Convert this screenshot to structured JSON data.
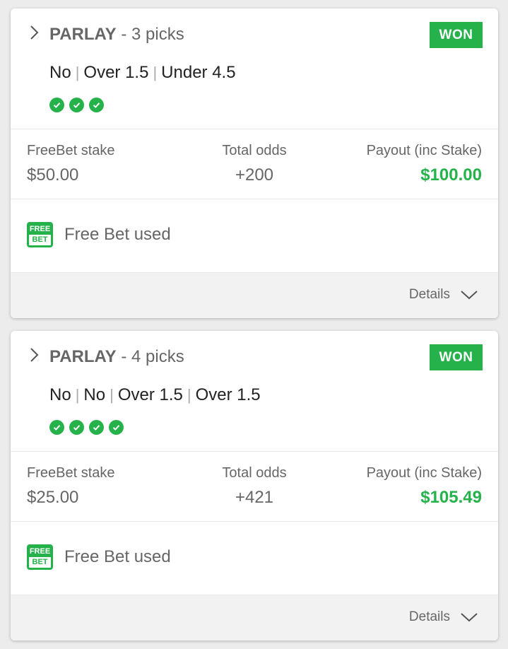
{
  "colors": {
    "accent": "#25b24a",
    "text_dark": "#222222",
    "text_muted": "#666666"
  },
  "bets": [
    {
      "type": "PARLAY",
      "picks_count": "- 3 picks",
      "status": "WON",
      "selections": [
        "No",
        "Over 1.5",
        "Under 4.5"
      ],
      "checks": 3,
      "stake_label": "FreeBet stake",
      "stake_value": "$50.00",
      "odds_label": "Total odds",
      "odds_value": "+200",
      "payout_label": "Payout (inc Stake)",
      "payout_value": "$100.00",
      "freebet_icon_top": "FREE",
      "freebet_icon_bottom": "BET",
      "freebet_text": "Free Bet used",
      "details_label": "Details"
    },
    {
      "type": "PARLAY",
      "picks_count": "- 4 picks",
      "status": "WON",
      "selections": [
        "No",
        "No",
        "Over 1.5",
        "Over 1.5"
      ],
      "checks": 4,
      "stake_label": "FreeBet stake",
      "stake_value": "$25.00",
      "odds_label": "Total odds",
      "odds_value": "+421",
      "payout_label": "Payout (inc Stake)",
      "payout_value": "$105.49",
      "freebet_icon_top": "FREE",
      "freebet_icon_bottom": "BET",
      "freebet_text": "Free Bet used",
      "details_label": "Details"
    }
  ]
}
